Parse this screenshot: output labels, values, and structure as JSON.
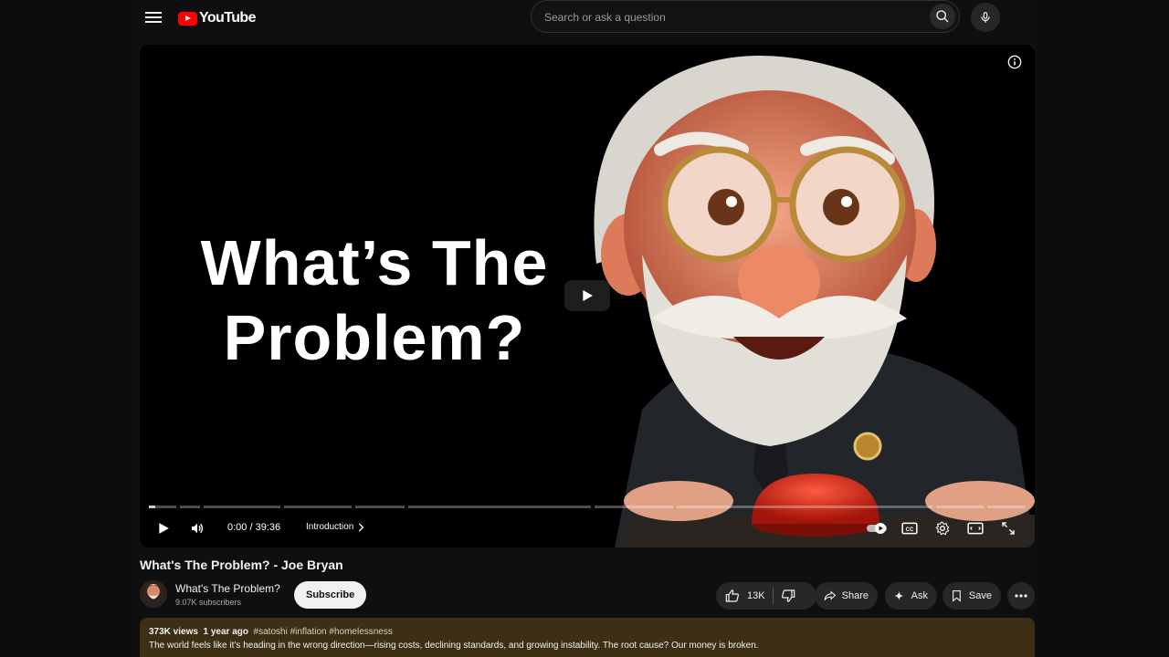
{
  "header": {
    "logo_text": "YouTube",
    "search_placeholder": "Search or ask a question"
  },
  "player": {
    "thumbnail_title_line1": "What’s The",
    "thumbnail_title_line2": "Problem?",
    "time": "0:00 / 39:36",
    "chapter": "Introduction"
  },
  "video": {
    "title": "What's The Problem? - Joe Bryan"
  },
  "channel": {
    "name": "What's The Problem?",
    "subscribers": "9.07K subscribers",
    "subscribe_label": "Subscribe"
  },
  "actions": {
    "likes": "13K",
    "share": "Share",
    "ask": "Ask",
    "save": "Save"
  },
  "description": {
    "views": "373K views",
    "age": "1 year ago",
    "tags": [
      "#satoshi",
      "#inflation",
      "#homelessness"
    ],
    "text": "The world feels like it’s heading in the wrong direction—rising costs, declining standards, and growing instability. The root cause? Our money is broken."
  },
  "colors": {
    "accent_red": "#ff0000",
    "background": "#0f0f0f",
    "description_bg": "#3d2f13"
  }
}
